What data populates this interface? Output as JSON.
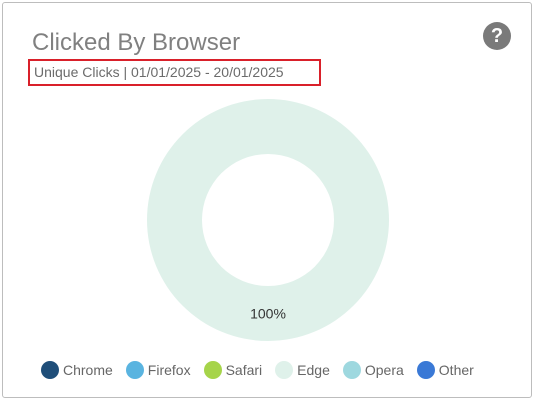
{
  "card": {
    "title": "Clicked By Browser",
    "subtitle": "Unique Clicks | 01/01/2025 - 20/01/2025",
    "help_icon": "question-mark-icon",
    "help_glyph": "?"
  },
  "colors": {
    "highlight_border": "#d9202a",
    "help_icon_bg": "#7a7a7a"
  },
  "chart_data": {
    "type": "pie",
    "variant": "donut",
    "categories": [
      "Chrome",
      "Firefox",
      "Safari",
      "Edge",
      "Opera",
      "Other"
    ],
    "values": [
      0,
      0,
      0,
      100,
      0,
      0
    ],
    "colors": [
      "#1f4e79",
      "#5ab4e0",
      "#a6d44a",
      "#dff1ea",
      "#9ed8df",
      "#3a79d6"
    ],
    "data_labels": [
      {
        "category": "Edge",
        "text": "100%"
      }
    ],
    "legend": "bottom"
  }
}
